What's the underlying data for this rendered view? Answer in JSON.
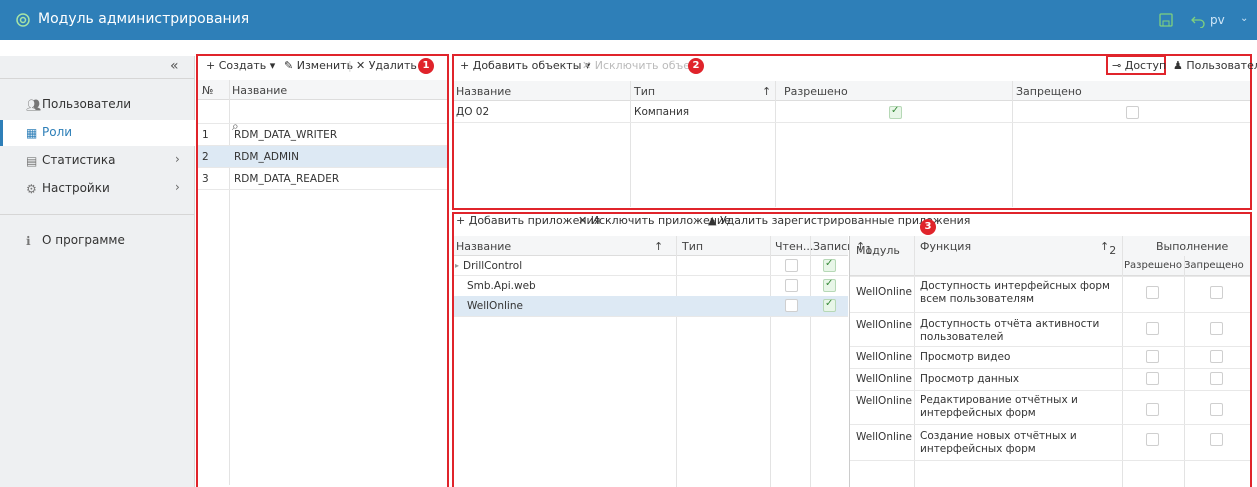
{
  "header": {
    "title": "Модуль администрирования",
    "user": "pv"
  },
  "sidebar": {
    "items": [
      {
        "label": "Пользователи",
        "icon": "users-icon"
      },
      {
        "label": "Роли",
        "icon": "roles-icon"
      },
      {
        "label": "Статистика",
        "icon": "chart-icon"
      },
      {
        "label": "Настройки",
        "icon": "gear-icon"
      },
      {
        "label": "О программе",
        "icon": "info-icon"
      }
    ]
  },
  "roles_panel": {
    "badge": "1",
    "toolbar": {
      "create": "Создать",
      "edit": "Изменить",
      "delete": "Удалить"
    },
    "columns": [
      "№",
      "Название"
    ],
    "rows": [
      {
        "num": "1",
        "name": "RDM_DATA_WRITER"
      },
      {
        "num": "2",
        "name": "RDM_ADMIN"
      },
      {
        "num": "3",
        "name": "RDM_DATA_READER"
      }
    ]
  },
  "objects_panel": {
    "badge": "2",
    "toolbar": {
      "add": "Добавить объекты",
      "remove": "Исключить объект",
      "access": "Доступ",
      "users": "Пользователи"
    },
    "columns": [
      "Название",
      "Тип",
      "Разрешено",
      "Запрещено"
    ],
    "rows": [
      {
        "name": "ДО 02",
        "type": "Компания",
        "allowed": true,
        "denied": false
      }
    ]
  },
  "apps_panel": {
    "badge": "3",
    "toolbar": {
      "add": "Добавить приложения",
      "remove": "Исключить приложение",
      "delete_registered": "Удалить зарегистрированные приложения"
    },
    "columns": [
      "Название",
      "Тип",
      "Чтен...",
      "Запись"
    ],
    "rows": [
      {
        "name": "DrillControl",
        "read": false,
        "write": true
      },
      {
        "name": "Smb.Api.web",
        "read": false,
        "write": true
      },
      {
        "name": "WellOnline",
        "read": false,
        "write": true
      }
    ],
    "func_columns": {
      "module": "Модуль",
      "module_sort": "1",
      "function": "Функция",
      "function_sort": "2",
      "exec": "Выполнение",
      "allowed": "Разрешено",
      "denied": "Запрещено"
    },
    "func_rows": [
      {
        "module": "WellOnline",
        "function": "Доступность интерфейсных форм всем пользователям"
      },
      {
        "module": "WellOnline",
        "function": "Доступность отчёта активности пользователей"
      },
      {
        "module": "WellOnline",
        "function": "Просмотр видео"
      },
      {
        "module": "WellOnline",
        "function": "Просмотр данных"
      },
      {
        "module": "WellOnline",
        "function": "Редактирование отчётных и интерфейсных форм"
      },
      {
        "module": "WellOnline",
        "function": "Создание новых отчётных и интерфейсных форм"
      }
    ]
  }
}
